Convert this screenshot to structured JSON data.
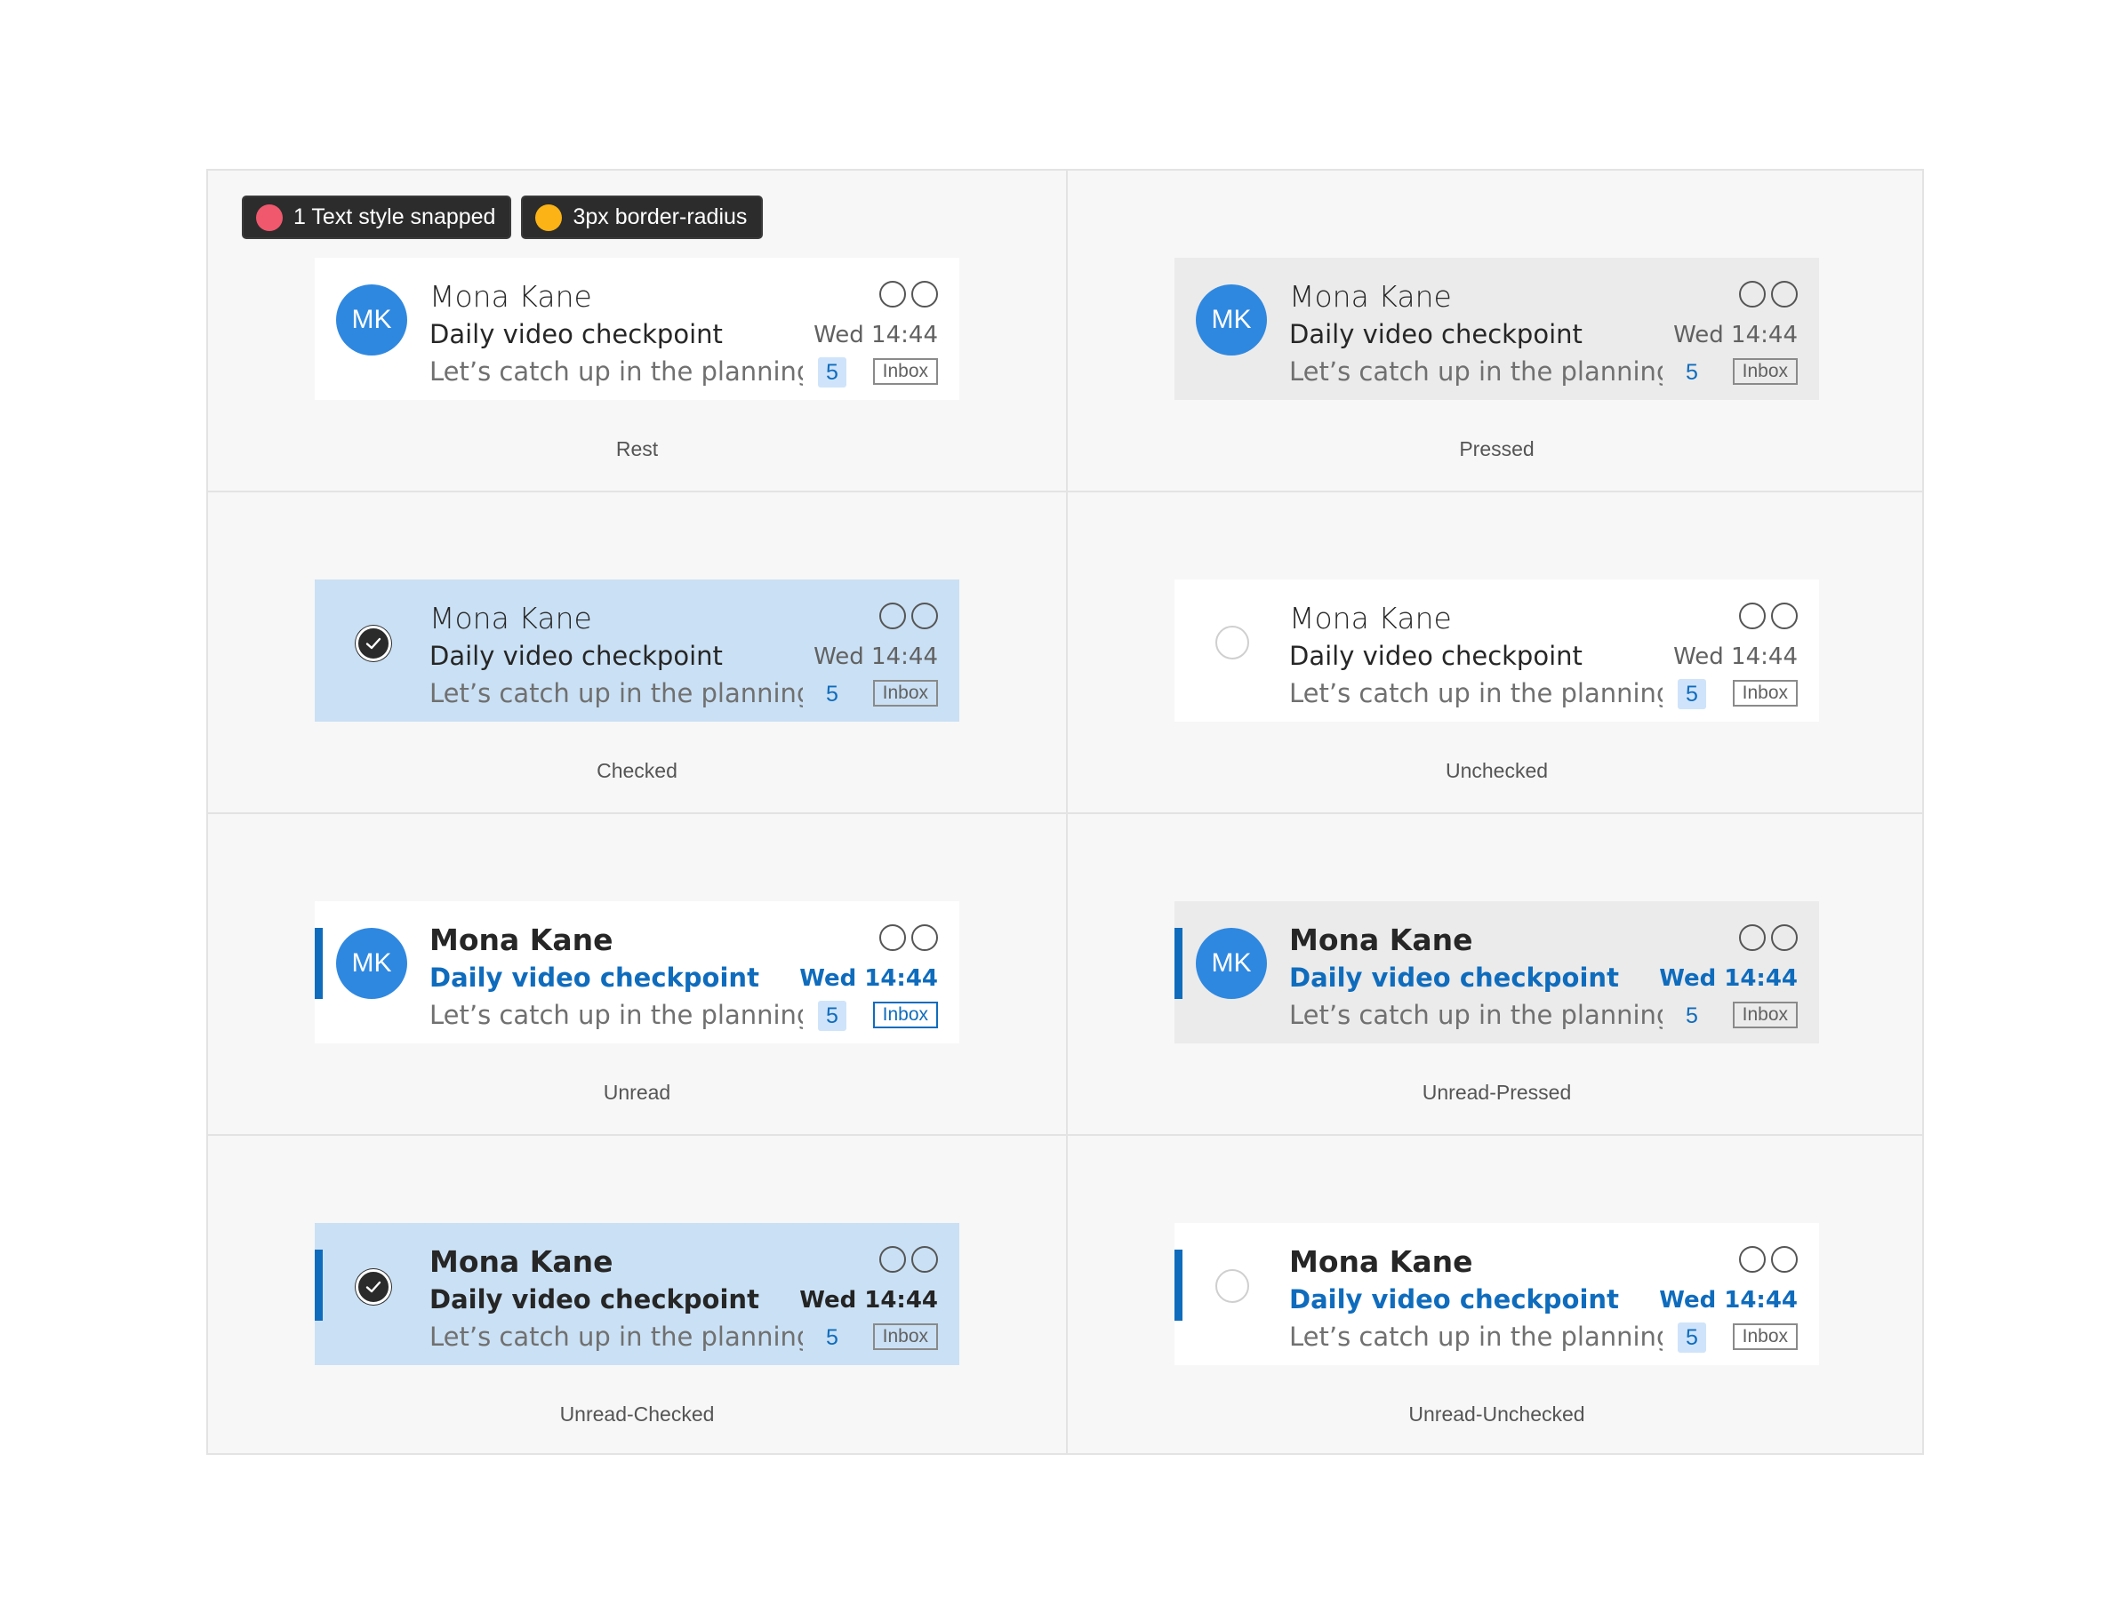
{
  "annotations": [
    {
      "label": "1 Text style snapped",
      "color": "#f0586d"
    },
    {
      "label": "3px border-radius",
      "color": "#fbb315"
    }
  ],
  "message": {
    "initials": "MK",
    "sender": "Mona Kane",
    "subject": "Daily video checkpoint",
    "time": "Wed 14:44",
    "preview": "Let’s catch up in the planning ...",
    "count": "5",
    "folder": "Inbox"
  },
  "states": {
    "rest": "Rest",
    "pressed": "Pressed",
    "checked": "Checked",
    "unchecked": "Unchecked",
    "unread": "Unread",
    "unread_pressed": "Unread-Pressed",
    "unread_checked": "Unread-Checked",
    "unread_unchecked": "Unread-Unchecked"
  },
  "colors": {
    "accent": "#0f6cbd",
    "avatar": "#2f88e0",
    "checked_bg": "#cae0f4",
    "pressed_bg": "#ebebeb"
  }
}
